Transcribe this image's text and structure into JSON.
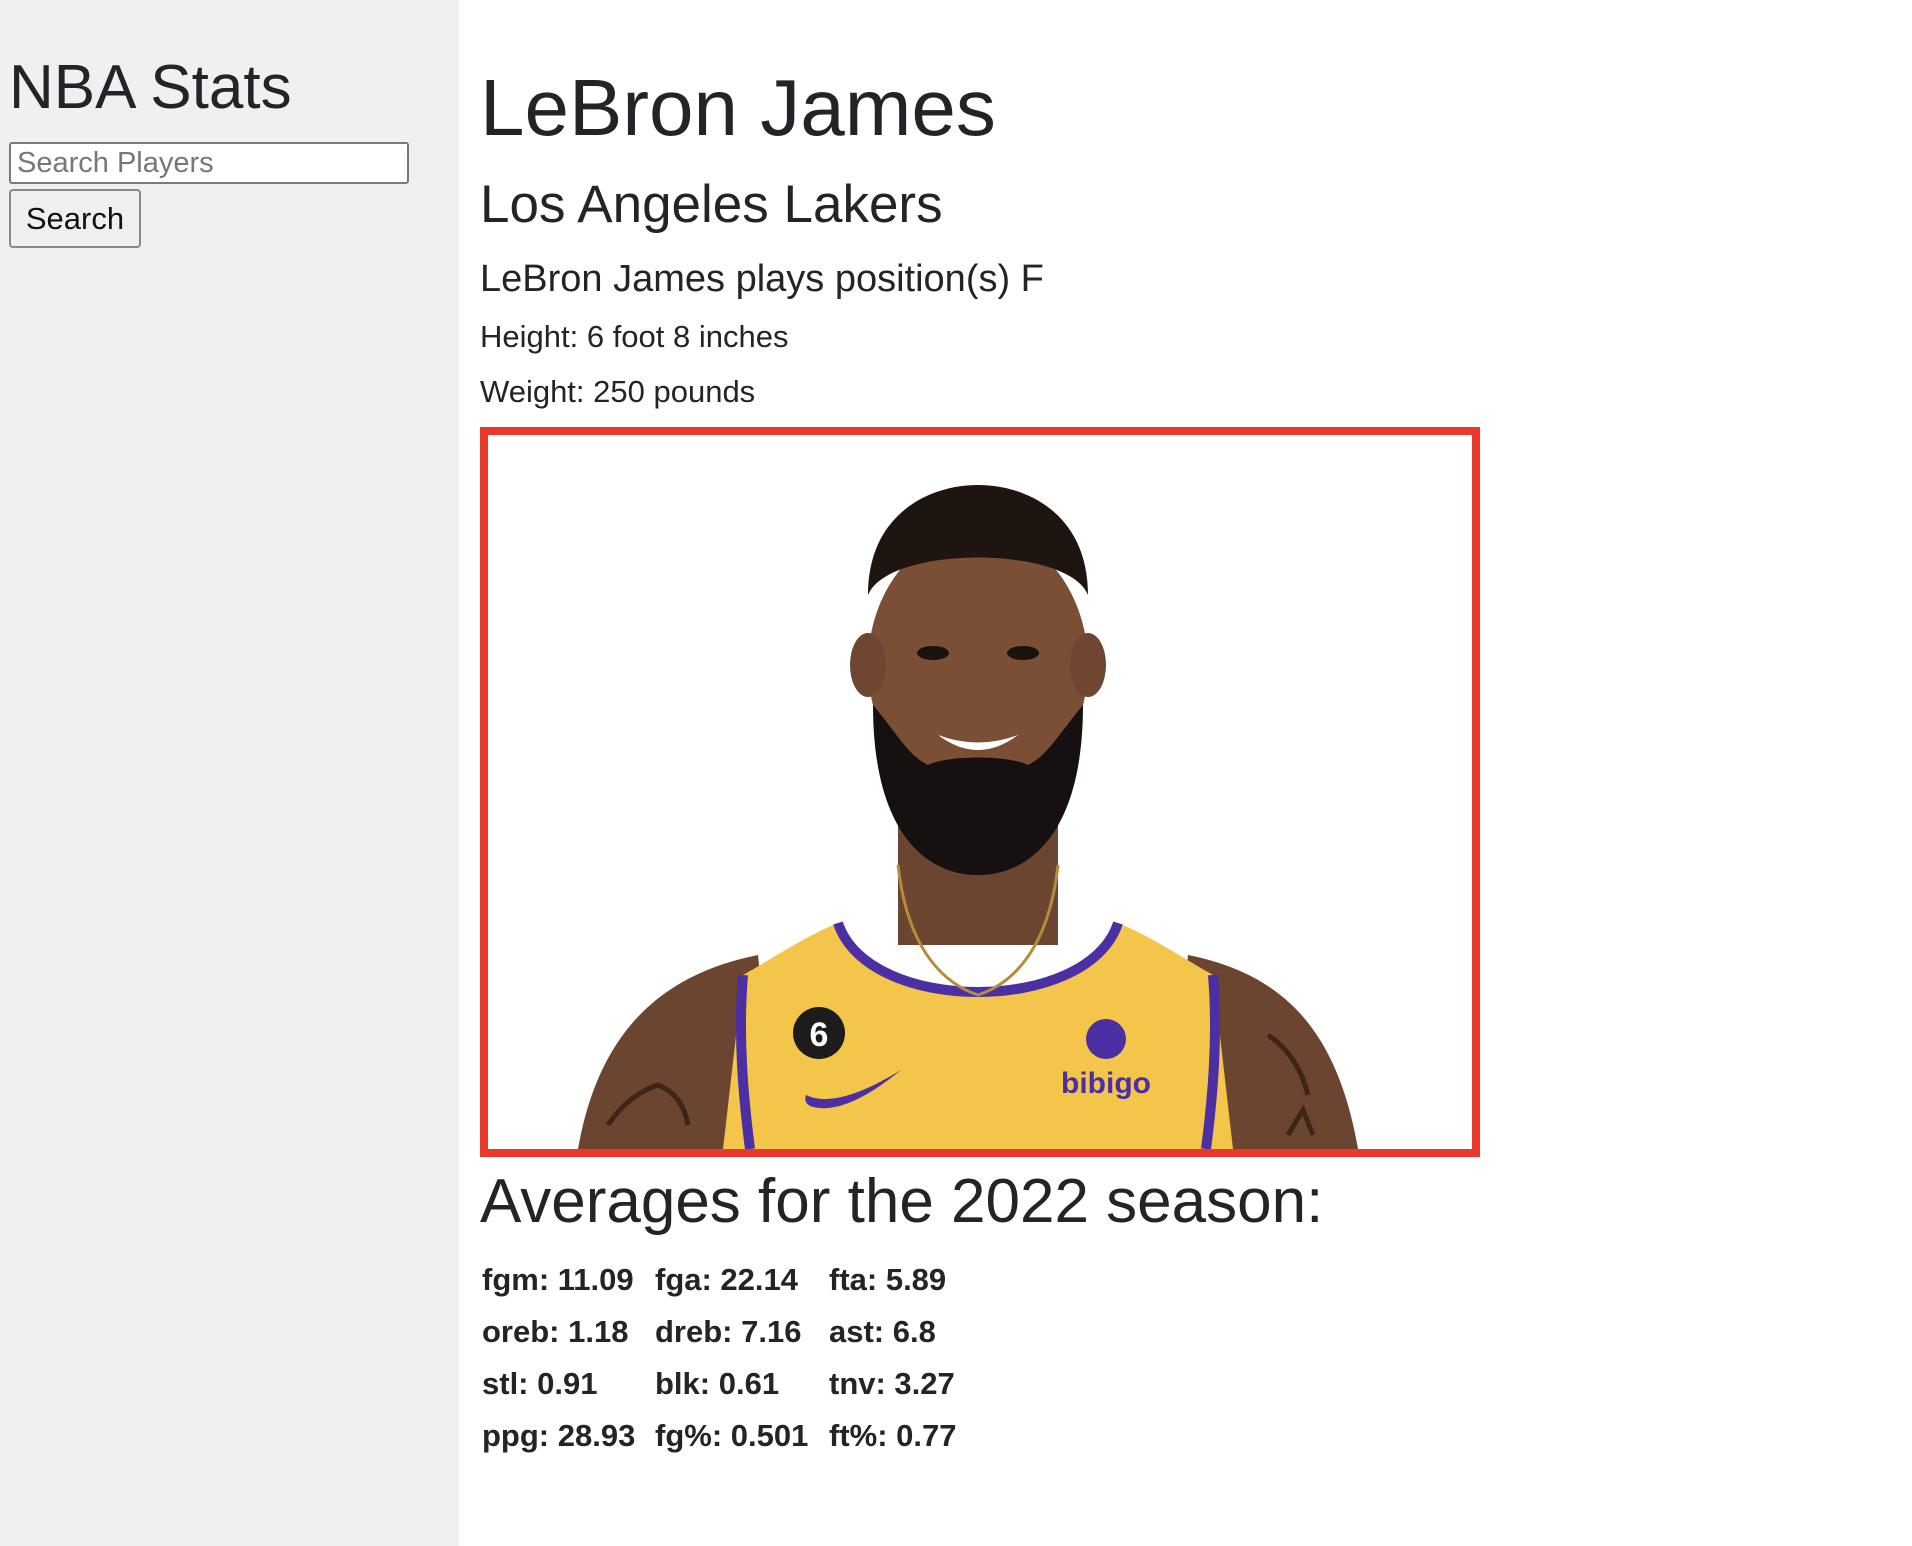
{
  "sidebar": {
    "title": "NBA Stats",
    "search_placeholder": "Search Players",
    "search_button_label": "Search"
  },
  "player": {
    "name": "LeBron James",
    "team": "Los Angeles Lakers",
    "position_text": "LeBron James plays position(s) F",
    "height_text": "Height: 6 foot 8 inches",
    "weight_text": "Weight: 250 pounds",
    "photo": {
      "jersey_number": "6",
      "sponsor": "bibigo",
      "frame_color": "#e8392b",
      "jersey_color": "#f3c54a",
      "trim_color": "#4b2fa3"
    }
  },
  "averages": {
    "title": "Averages for the 2022 season:",
    "rows": [
      [
        "fgm: 11.09",
        "fga: 22.14",
        "fta: 5.89"
      ],
      [
        "oreb: 1.18",
        "dreb: 7.16",
        "ast: 6.8"
      ],
      [
        "stl: 0.91",
        "blk: 0.61",
        "tnv: 3.27"
      ],
      [
        "ppg: 28.93",
        "fg%: 0.501",
        "ft%: 0.77"
      ]
    ]
  }
}
